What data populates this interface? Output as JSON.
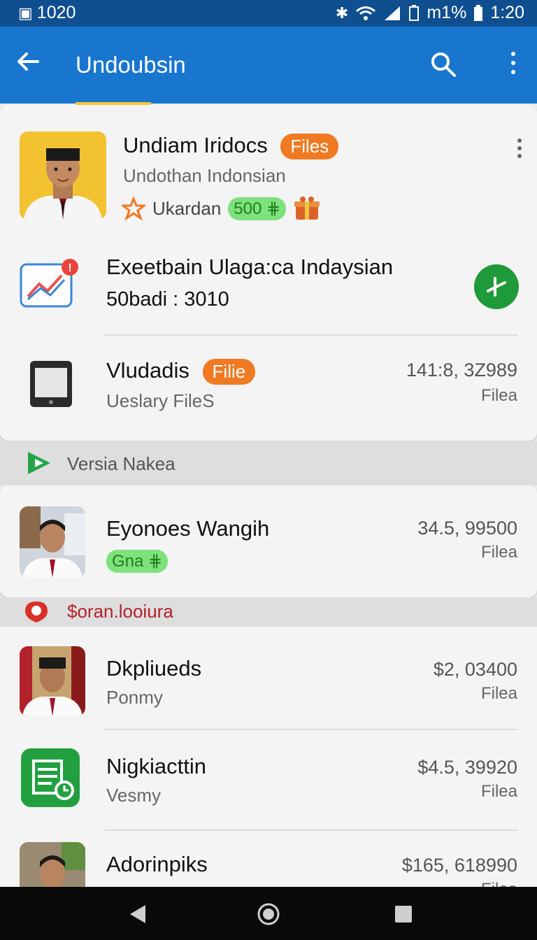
{
  "status_bar": {
    "left_text": "1020",
    "battery_text": "m1%",
    "time": "1:20"
  },
  "app_bar": {
    "title": "Undoubsin",
    "icons": [
      "back-arrow-icon",
      "search-icon",
      "more-vert-icon"
    ]
  },
  "profile": {
    "name": "Undiam Iridocs",
    "badge": "Files",
    "subtitle": "Undothan Indonsian",
    "location": "Ukardan",
    "tag": "500"
  },
  "featured": {
    "title": "Exeetbain Ulaga:ca Indaysian",
    "subtitle": "50badi : 3010",
    "notification_count": "!"
  },
  "tablet_item": {
    "name": "Vludadis",
    "badge": "Filie",
    "subtitle": "Ueslary FileS",
    "amount": "141:8, 3Z989",
    "unit": "Filea"
  },
  "section1": {
    "label": "Versia Nakea"
  },
  "person1": {
    "name": "Eyonoes Wangih",
    "tag": "Gna",
    "amount": "34.5, 99500",
    "unit": "Filea"
  },
  "section2": {
    "label": "$oran.looiura"
  },
  "list": [
    {
      "name": "Dkpliueds",
      "subtitle": "Ponmy",
      "amount": "$2, 03400",
      "unit": "Filea"
    },
    {
      "name": "Nigkiacttin",
      "subtitle": "Vesmy",
      "amount": "$4.5, 39920",
      "unit": "Filea"
    },
    {
      "name": "Adorinpiks",
      "subtitle": "",
      "amount": "$165, 618990",
      "unit": "Filea"
    }
  ],
  "colors": {
    "appbar": "#1876cf",
    "statusbar": "#0f4f8f",
    "accent_orange": "#f07a22",
    "accent_green": "#1f9a3a"
  }
}
